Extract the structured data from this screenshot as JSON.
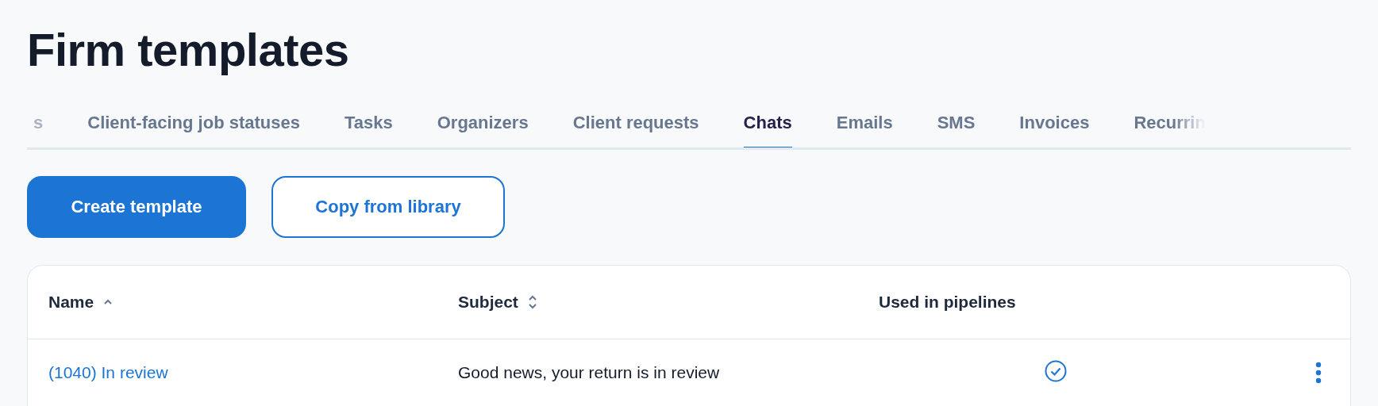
{
  "title": "Firm templates",
  "tabs": [
    {
      "label": "s",
      "selected": false,
      "kind": "clipped"
    },
    {
      "label": "Client-facing job statuses",
      "selected": false
    },
    {
      "label": "Tasks",
      "selected": false
    },
    {
      "label": "Organizers",
      "selected": false
    },
    {
      "label": "Client requests",
      "selected": false
    },
    {
      "label": "Chats",
      "selected": true
    },
    {
      "label": "Emails",
      "selected": false
    },
    {
      "label": "SMS",
      "selected": false
    },
    {
      "label": "Invoices",
      "selected": false
    },
    {
      "label": "Recurrin",
      "selected": false,
      "kind": "clipped"
    }
  ],
  "actions": [
    {
      "label": "Create template",
      "kind": "primary"
    },
    {
      "label": "Copy from library",
      "kind": "outline"
    }
  ],
  "table": {
    "columns": [
      {
        "label": "Name",
        "kind": "sorted"
      },
      {
        "label": "Subject",
        "kind": "sortable"
      },
      {
        "label": "Used in pipelines",
        "kind": "plain"
      }
    ],
    "rows": [
      {
        "name": "(1040) In review",
        "subject": "Good news, your return is in review",
        "used": true
      }
    ]
  }
}
